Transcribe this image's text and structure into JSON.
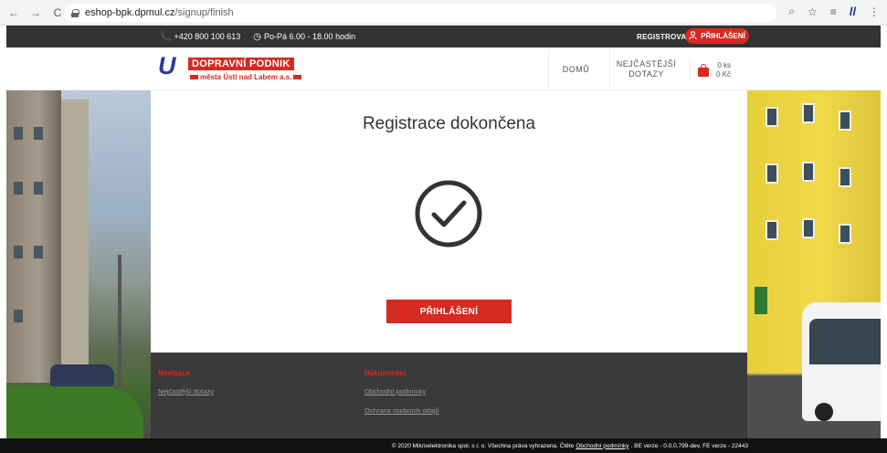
{
  "browser": {
    "back_icon": "←",
    "forward_icon": "→",
    "reload_icon": "C",
    "url_host": "eshop-bpk.dpmul.cz",
    "url_path": "/signup/finish",
    "zoom_icon": "⌕",
    "star_icon": "☆",
    "menu_icon": "⋮",
    "extension_icon": "ll",
    "list_icon": "≡"
  },
  "topbar": {
    "phone": "+420 800 100 613",
    "hours": "Po-Pá 6.00 - 18.00 hodin",
    "register": "REGISTROVAT",
    "login": "PŘIHLÁŠENÍ"
  },
  "header": {
    "logo_mark": "U",
    "logo_top": "DOPRAVNÍ PODNIK",
    "logo_bottom": "města Ústí nad Labem a.s.",
    "nav_home": "DOMŮ",
    "nav_faq_line1": "NEJČASTĚJŠÍ",
    "nav_faq_line2": "DOTAZY",
    "cart_count": "0 ks",
    "cart_total": "0 Kč"
  },
  "main": {
    "title": "Registrace dokončena",
    "login_button": "PŘIHLÁŠENÍ"
  },
  "footer": {
    "nav_heading": "Navigace",
    "nav_faq": "Nejčastější dotazy",
    "shop_heading": "Nakupování",
    "shop_terms": "Obchodní podmínky",
    "shop_privacy": "Ochrana osobních údajů",
    "copyright_pre": "© 2020 Mikroelektronika spol. s r. o. Všechna práva vyhrazena. Čtěte",
    "copyright_link": "Obchodní podmínky",
    "copyright_post": ". BE verze - 0.0.0.799-dev, FE verze - 22443"
  },
  "colors": {
    "accent": "#d62a22",
    "brand_blue": "#2a3a9e",
    "dark_bar": "#333333",
    "footer_bg": "#3a3a3a"
  }
}
